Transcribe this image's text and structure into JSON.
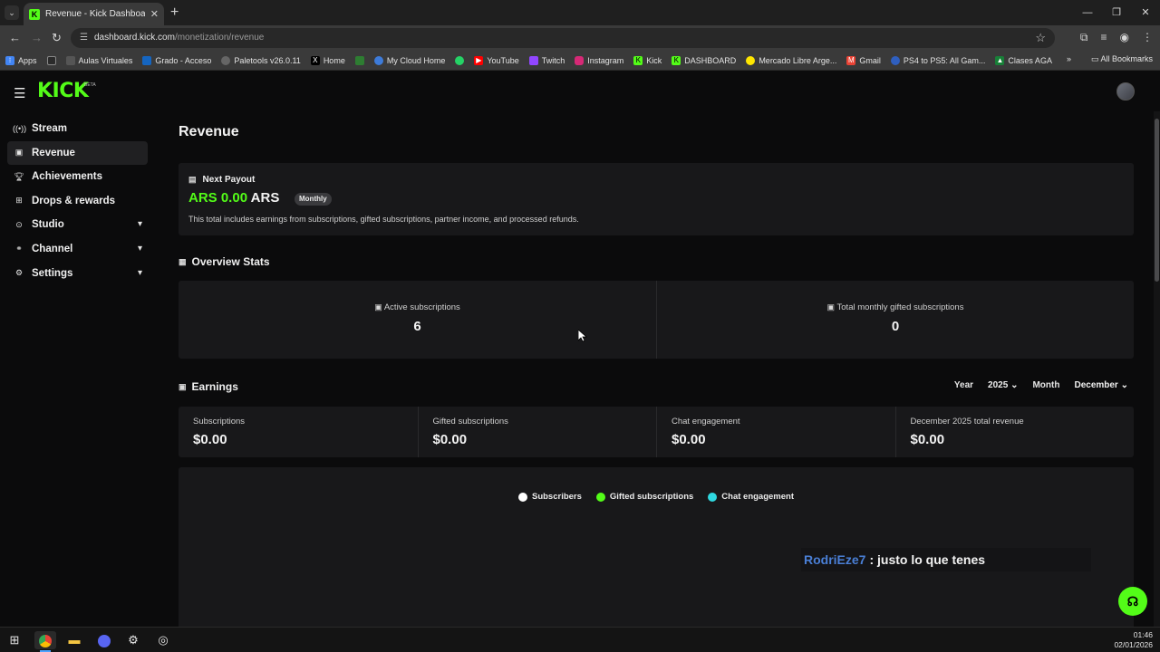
{
  "browser": {
    "tab_title": "Revenue - Kick Dashboard",
    "url_host": "dashboard.kick.com",
    "url_path": "/monetization/revenue",
    "bookmarks": [
      {
        "label": "Apps",
        "color": "#4285f4"
      },
      {
        "label": "Aulas Virtuales",
        "color": "#2b2b2b"
      },
      {
        "label": "Grado - Acceso",
        "color": "#1565c0"
      },
      {
        "label": "Paletools v26.0.11",
        "color": "#555555"
      },
      {
        "label": "Home",
        "color": "#000000"
      },
      {
        "label": "My Cloud Home",
        "color": "#3d7bd9"
      },
      {
        "label": "YouTube",
        "color": "#ff0000"
      },
      {
        "label": "Twitch",
        "color": "#9146ff"
      },
      {
        "label": "Instagram",
        "color": "#d62976"
      },
      {
        "label": "Kick",
        "color": "#53fc18"
      },
      {
        "label": "DASHBOARD",
        "color": "#53fc18"
      },
      {
        "label": "Mercado Libre Arge...",
        "color": "#ffe600"
      },
      {
        "label": "Gmail",
        "color": "#ea4335"
      },
      {
        "label": "PS4 to PS5: All Gam...",
        "color": "#2f5fbf"
      },
      {
        "label": "Clases AGA",
        "color": "#188038"
      }
    ],
    "all_bookmarks": "All Bookmarks"
  },
  "app": {
    "logo": "KICK",
    "logo_beta": "BETA"
  },
  "sidebar": {
    "items": [
      {
        "label": "Stream",
        "icon": "broadcast-icon"
      },
      {
        "label": "Revenue",
        "icon": "revenue-icon"
      },
      {
        "label": "Achievements",
        "icon": "trophy-icon"
      },
      {
        "label": "Drops & rewards",
        "icon": "gift-icon"
      },
      {
        "label": "Studio",
        "icon": "studio-icon"
      },
      {
        "label": "Channel",
        "icon": "channel-icon"
      },
      {
        "label": "Settings",
        "icon": "gear-icon"
      }
    ]
  },
  "page": {
    "title": "Revenue",
    "payout": {
      "heading": "Next Payout",
      "amount": "ARS 0.00",
      "currency": "ARS",
      "badge": "Monthly",
      "note": "This total includes earnings from subscriptions, gifted subscriptions, partner income, and processed refunds."
    },
    "overview": {
      "heading": "Overview Stats",
      "stats": [
        {
          "label": "Active subscriptions",
          "value": "6"
        },
        {
          "label": "Total monthly gifted subscriptions",
          "value": "0"
        }
      ]
    },
    "earnings": {
      "heading": "Earnings",
      "year_label": "Year",
      "year_value": "2025",
      "month_label": "Month",
      "month_value": "December",
      "cells": [
        {
          "label": "Subscriptions",
          "value": "$0.00"
        },
        {
          "label": "Gifted subscriptions",
          "value": "$0.00"
        },
        {
          "label": "Chat engagement",
          "value": "$0.00"
        },
        {
          "label": "December 2025 total revenue",
          "value": "$0.00"
        }
      ],
      "legend": [
        {
          "label": "Subscribers",
          "color": "#ffffff"
        },
        {
          "label": "Gifted subscriptions",
          "color": "#53fc18"
        },
        {
          "label": "Chat engagement",
          "color": "#2fd8e0"
        }
      ]
    },
    "chat_overlay": {
      "user": "RodriEze7",
      "message": ": justo lo que tenes"
    }
  },
  "taskbar": {
    "time": "01:46",
    "date": "02/01/2026"
  }
}
